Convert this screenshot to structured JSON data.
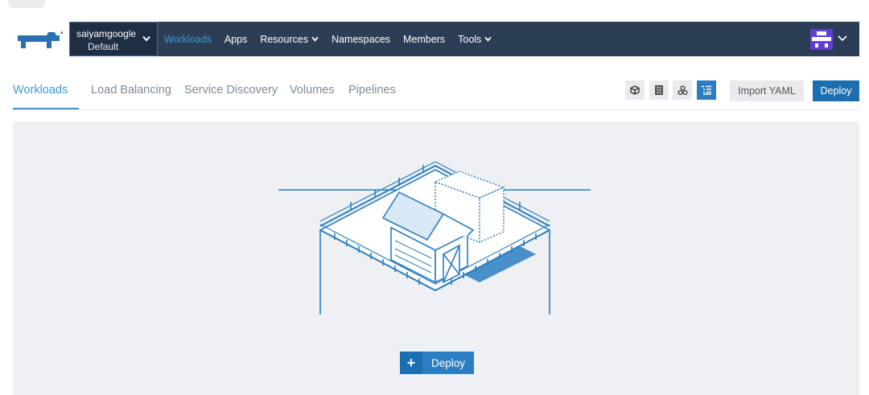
{
  "navbar": {
    "context": {
      "cluster": "saiyamgoogle",
      "project": "Default"
    },
    "menu": [
      {
        "label": "Workloads",
        "active": true,
        "dropdown": false
      },
      {
        "label": "Apps",
        "active": false,
        "dropdown": false
      },
      {
        "label": "Resources",
        "active": false,
        "dropdown": true
      },
      {
        "label": "Namespaces",
        "active": false,
        "dropdown": false
      },
      {
        "label": "Members",
        "active": false,
        "dropdown": false
      },
      {
        "label": "Tools",
        "active": false,
        "dropdown": true
      }
    ]
  },
  "tabs": [
    {
      "label": "Workloads",
      "active": true
    },
    {
      "label": "Load Balancing",
      "active": false
    },
    {
      "label": "Service Discovery",
      "active": false
    },
    {
      "label": "Volumes",
      "active": false
    },
    {
      "label": "Pipelines",
      "active": false
    }
  ],
  "view_toggles": [
    "cube-icon",
    "list-icon",
    "cluster-icon",
    "tree-list-icon"
  ],
  "actions": {
    "import_label": "Import YAML",
    "deploy_label": "Deploy"
  },
  "empty_state": {
    "deploy_label": "Deploy"
  },
  "colors": {
    "nav_bg": "#2c3e56",
    "accent": "#3d98d3",
    "primary": "#1d6eaf",
    "panel_bg": "#eef0f3"
  }
}
